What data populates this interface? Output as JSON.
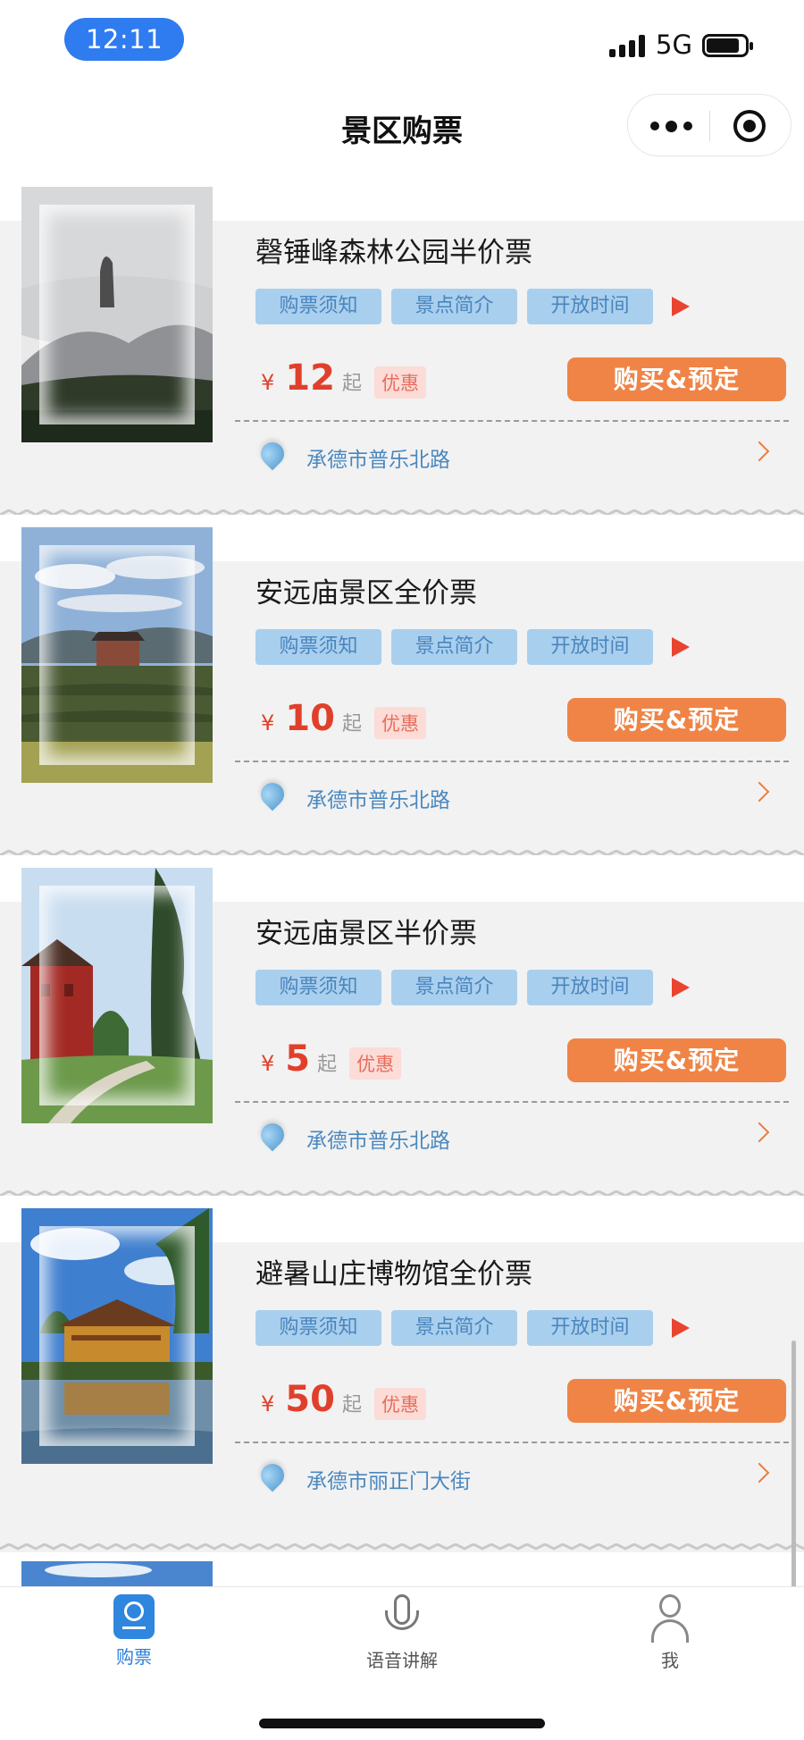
{
  "status_bar": {
    "time": "12:11",
    "network": "5G"
  },
  "nav": {
    "title": "景区购票"
  },
  "tickets": [
    {
      "name": "磬锤峰森林公园半价票",
      "price": "12",
      "address": "承德市普乐北路"
    },
    {
      "name": "安远庙景区全价票",
      "price": "10",
      "address": "承德市普乐北路"
    },
    {
      "name": "安远庙景区半价票",
      "price": "5",
      "address": "承德市普乐北路"
    },
    {
      "name": "避暑山庄博物馆全价票",
      "price": "50",
      "address": "承德市丽正门大街"
    }
  ],
  "labels": {
    "tag_notice": "购票须知",
    "tag_intro": "景点简介",
    "tag_hours": "开放时间",
    "currency": "¥",
    "from": "起",
    "discount": "优惠",
    "buy": "购买&预定"
  },
  "tab_bar": {
    "tickets": "购票",
    "audio": "语音讲解",
    "me": "我"
  },
  "colors": {
    "accent_blue": "#2f7bf0",
    "price_red": "#e0402b",
    "buy_orange": "#ef8446",
    "tag_blue": "#a9cfee"
  }
}
